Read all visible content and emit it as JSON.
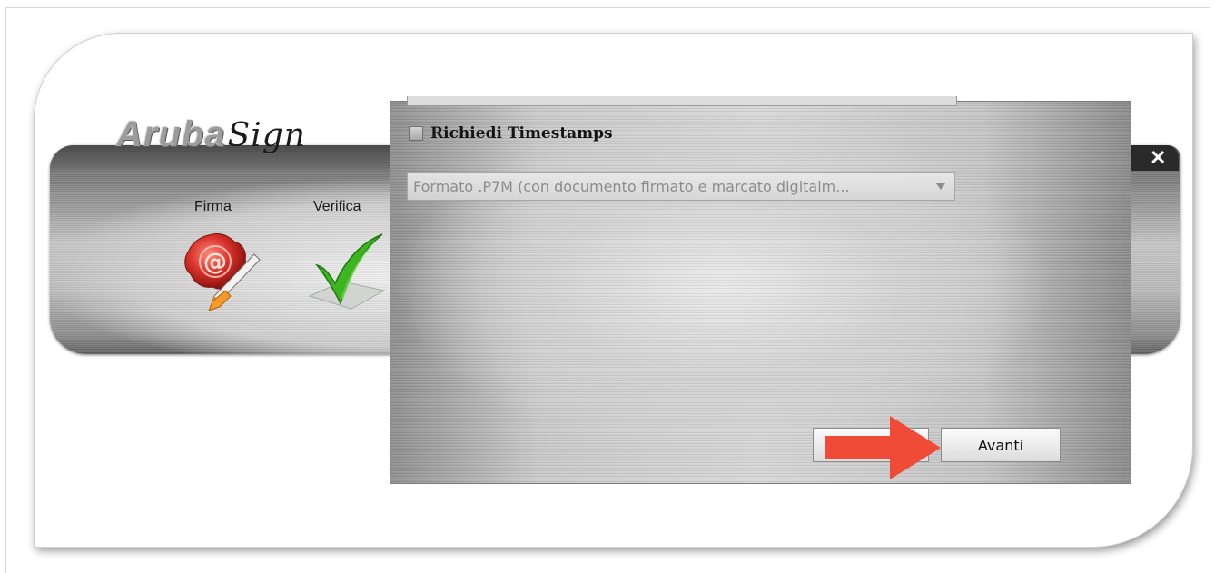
{
  "app": {
    "logo_main": "Aruba",
    "logo_sign": "Sign"
  },
  "toolbar": {
    "tools": [
      {
        "label": "Firma",
        "icon": "wax-seal-pen-icon"
      },
      {
        "label": "Verifica",
        "icon": "green-checkmark-icon"
      }
    ]
  },
  "window_controls": {
    "close_label": "✕"
  },
  "dialog": {
    "timestamp_checkbox": {
      "label": "Richiedi Timestamps",
      "checked": false
    },
    "format_select": {
      "selected": "Formato .P7M (con documento firmato e marcato digitalm...",
      "enabled": false
    },
    "buttons": {
      "back_label": "",
      "next_label": "Avanti"
    }
  },
  "annotation": {
    "arrow_color": "#ef4b36"
  }
}
